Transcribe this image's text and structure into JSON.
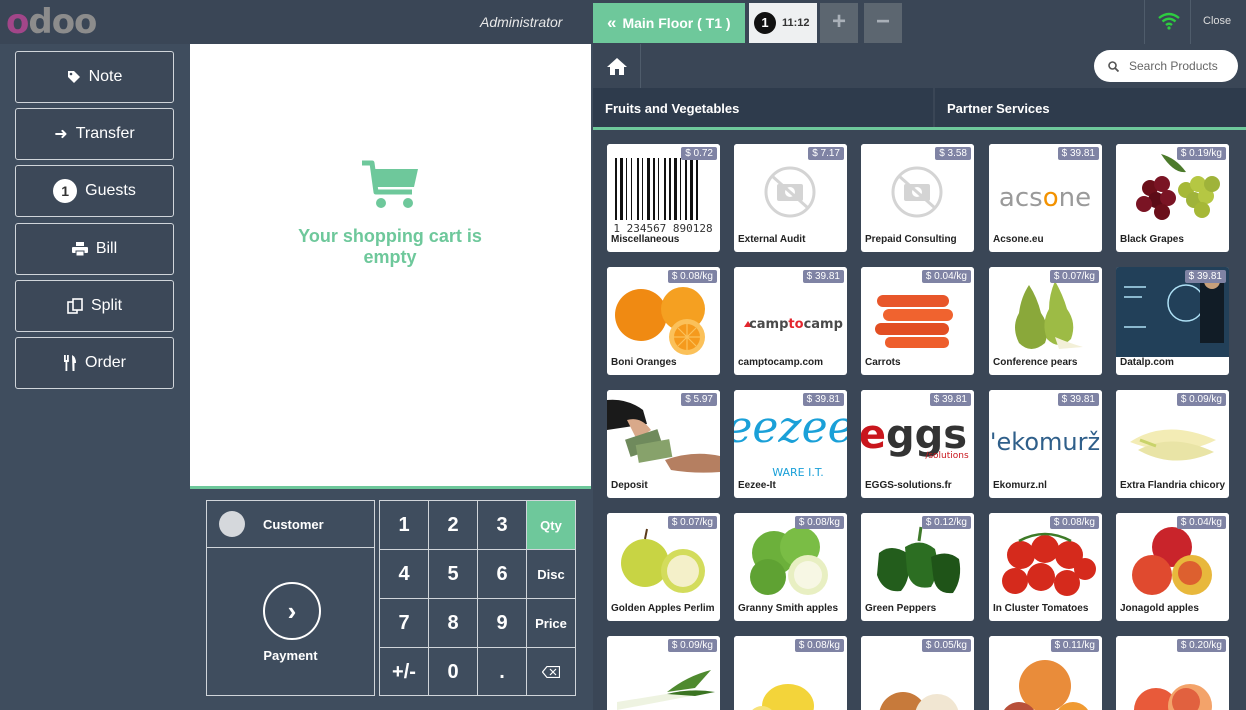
{
  "header": {
    "logo_first": "o",
    "logo_rest": "doo",
    "user": "Administrator",
    "floor_button": "Main Floor ( T1 )",
    "order_number": "1",
    "order_time": "11:12",
    "add_order": "+",
    "remove_order": "−",
    "close": "Close"
  },
  "controls": {
    "note": "Note",
    "transfer": "Transfer",
    "guests_count": "1",
    "guests": "Guests",
    "bill": "Bill",
    "split": "Split",
    "order": "Order"
  },
  "order": {
    "empty_message": "Your shopping cart is empty"
  },
  "actionpad": {
    "customer": "Customer",
    "payment": "Payment"
  },
  "numpad": {
    "keys": [
      "1",
      "2",
      "3",
      "Qty",
      "4",
      "5",
      "6",
      "Disc",
      "7",
      "8",
      "9",
      "Price",
      "+/-",
      "0",
      ".",
      "⌫"
    ],
    "active_mode": "Qty"
  },
  "products_panel": {
    "search_placeholder": "Search Products",
    "categories": [
      "Fruits and Vegetables",
      "Partner Services"
    ]
  },
  "products": [
    {
      "name": "Miscellaneous",
      "price": "$ 0.72",
      "image": "barcode"
    },
    {
      "name": "External Audit",
      "price": "$ 7.17",
      "image": "no-photo"
    },
    {
      "name": "Prepaid Consulting",
      "price": "$ 3.58",
      "image": "no-photo"
    },
    {
      "name": "Acsone.eu",
      "price": "$ 39.81",
      "image": "acsone-logo"
    },
    {
      "name": "Black Grapes",
      "price": "$ 0.19/kg",
      "image": "grapes"
    },
    {
      "name": "Boni Oranges",
      "price": "$ 0.08/kg",
      "image": "oranges"
    },
    {
      "name": "camptocamp.com",
      "price": "$ 39.81",
      "image": "camptocamp-logo"
    },
    {
      "name": "Carrots",
      "price": "$ 0.04/kg",
      "image": "carrots"
    },
    {
      "name": "Conference pears",
      "price": "$ 0.07/kg",
      "image": "pears"
    },
    {
      "name": "Datalp.com",
      "price": "$ 39.81",
      "image": "datalp-photo"
    },
    {
      "name": "Deposit",
      "price": "$ 5.97",
      "image": "money-hands"
    },
    {
      "name": "Eezee-It",
      "price": "$ 39.81",
      "image": "eezee-logo"
    },
    {
      "name": "EGGS-solutions.fr",
      "price": "$ 39.81",
      "image": "eggs-logo"
    },
    {
      "name": "Ekomurz.nl",
      "price": "$ 39.81",
      "image": "ekomurz-logo"
    },
    {
      "name": "Extra Flandria chicory",
      "price": "$ 0.09/kg",
      "image": "chicory"
    },
    {
      "name": "Golden Apples Perlim",
      "price": "$ 0.07/kg",
      "image": "golden-apples"
    },
    {
      "name": "Granny Smith apples",
      "price": "$ 0.08/kg",
      "image": "green-apples"
    },
    {
      "name": "Green Peppers",
      "price": "$ 0.12/kg",
      "image": "green-peppers"
    },
    {
      "name": "In Cluster Tomatoes",
      "price": "$ 0.08/kg",
      "image": "tomatoes"
    },
    {
      "name": "Jonagold apples",
      "price": "$ 0.04/kg",
      "image": "jonagold-apples"
    },
    {
      "name": "",
      "price": "$ 0.09/kg",
      "image": "leek"
    },
    {
      "name": "",
      "price": "$ 0.08/kg",
      "image": "lemons"
    },
    {
      "name": "",
      "price": "$ 0.05/kg",
      "image": "onions"
    },
    {
      "name": "",
      "price": "$ 0.11/kg",
      "image": "blood-oranges"
    },
    {
      "name": "",
      "price": "$ 0.20/kg",
      "image": "peaches"
    }
  ],
  "colors": {
    "accent": "#6ec89b",
    "header": "#3a4656",
    "price_badge": "#7f83a4",
    "logo_purple": "#a24689"
  },
  "icons": {
    "home": "home-icon",
    "search": "search-icon",
    "wifi": "wifi-icon",
    "cart": "cart-icon"
  }
}
